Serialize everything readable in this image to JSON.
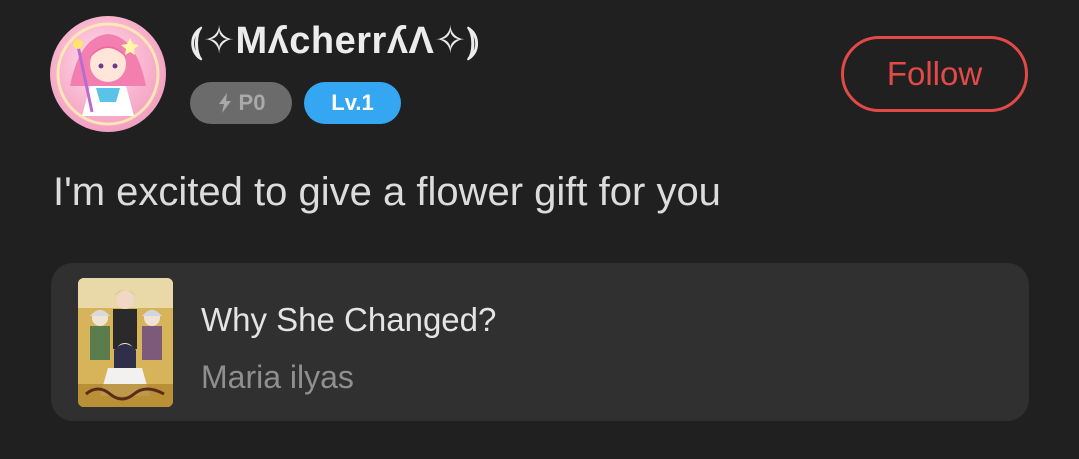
{
  "user": {
    "name": "⦅✧MʎcherrʎΛ✧⦆",
    "avatar_icon": "anime-girl-avatar"
  },
  "badges": {
    "points_label": "P0",
    "points_icon": "lightning-icon",
    "level_label": "Lv.1"
  },
  "follow_button": {
    "label": "Follow"
  },
  "post": {
    "message": "I'm excited to give a flower gift for you"
  },
  "book": {
    "title": "Why She Changed?",
    "author": "Maria ilyas",
    "cover_icon": "book-cover-image"
  },
  "colors": {
    "background": "#202020",
    "card": "#303030",
    "follow_accent": "#e24a47",
    "level_badge": "#35a7f2",
    "points_badge": "#6b6b6b"
  }
}
